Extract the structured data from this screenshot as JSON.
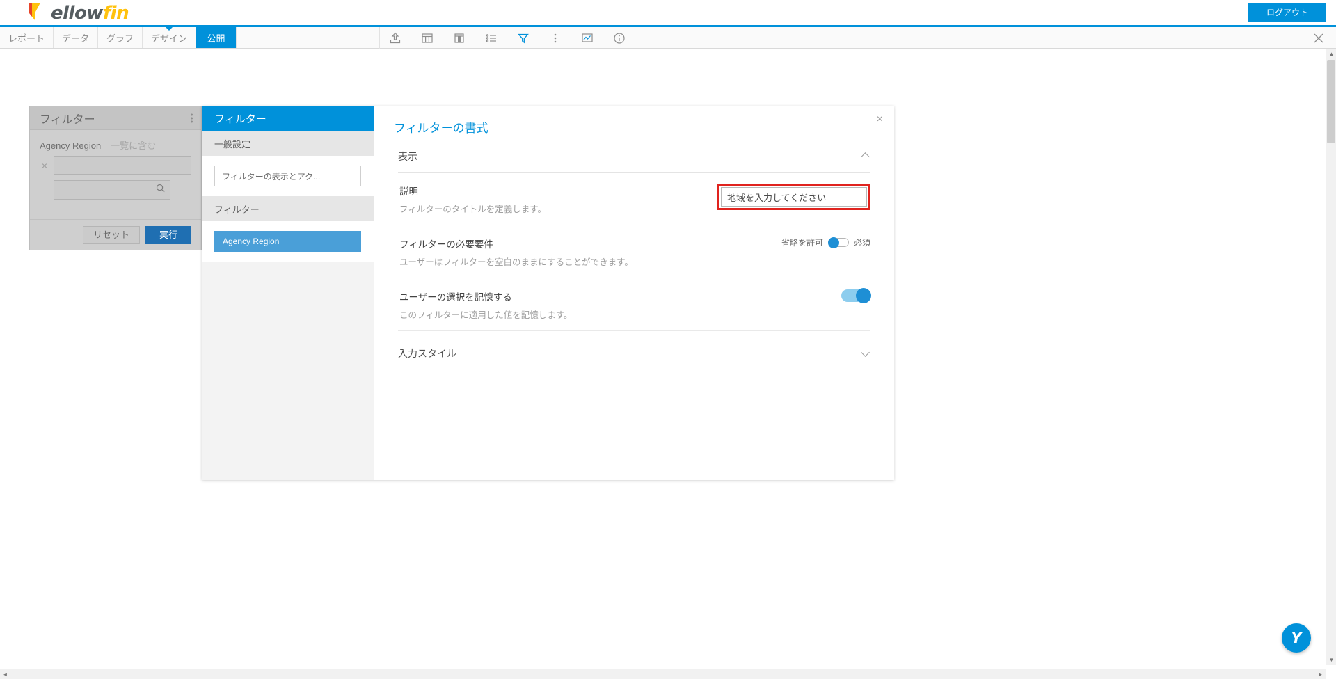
{
  "app": {
    "brand_first": "ellow",
    "brand_second": "fin",
    "logo_icon": "yellowfin-logo-icon",
    "accent_color": "#0091DA",
    "highlight_color": "#E0231E"
  },
  "topbar": {
    "logout_label": "ログアウト"
  },
  "nav": {
    "tabs": [
      {
        "label": "レポート",
        "active": false
      },
      {
        "label": "データ",
        "active": false
      },
      {
        "label": "グラフ",
        "active": false
      },
      {
        "label": "デザイン",
        "active": false
      },
      {
        "label": "公開",
        "active": true
      }
    ]
  },
  "toolbar": {
    "buttons": [
      {
        "name": "export-icon",
        "title": "エクスポート",
        "active": false
      },
      {
        "name": "table-columns-icon",
        "title": "表",
        "active": false
      },
      {
        "name": "section-layout-icon",
        "title": "セクション",
        "active": false
      },
      {
        "name": "list-icon",
        "title": "リスト",
        "active": false
      },
      {
        "name": "filter-icon",
        "title": "フィルター",
        "active": true
      },
      {
        "name": "more-vertical-icon",
        "title": "その他",
        "active": false
      },
      {
        "name": "chart-icon",
        "title": "グラフ",
        "active": false
      },
      {
        "name": "info-icon",
        "title": "情報",
        "active": false
      }
    ],
    "close_label": "×"
  },
  "filter_panel": {
    "title": "フィルター",
    "menu_icon": "kebab-menu-icon",
    "field_label": "Agency Region",
    "operator_label": "一覧に含む",
    "remove_icon": "remove-x-icon",
    "value_input_value": "",
    "search_input_value": "",
    "search_icon": "search-icon",
    "reset_label": "リセット",
    "run_label": "実行"
  },
  "modal": {
    "left": {
      "header": "フィルター",
      "section_general": "一般設定",
      "chip_label": "フィルターの表示とアク...",
      "section_filters": "フィルター",
      "items": [
        {
          "label": "Agency Region",
          "selected": true
        }
      ]
    },
    "right": {
      "title": "フィルターの書式",
      "close_icon": "close-icon",
      "sections": [
        {
          "name": "display-section",
          "heading": "表示",
          "expanded": true,
          "rows": [
            {
              "name": "description-row",
              "label": "説明",
              "desc": "フィルターのタイトルを定義します。",
              "control": "text-input",
              "value": "地域を入力してください",
              "placeholder": "",
              "highlighted": true
            },
            {
              "name": "requirement-row",
              "label": "フィルターの必要要件",
              "desc": "ユーザーはフィルターを空白のままにすることができます。",
              "control": "radio-toggle",
              "option_left": "省略を許可",
              "option_right": "必須",
              "selected": "省略を許可"
            },
            {
              "name": "remember-selection-row",
              "label": "ユーザーの選択を記憶する",
              "desc": "このフィルターに適用した値を記憶します。",
              "control": "toggle",
              "value": "on"
            }
          ]
        },
        {
          "name": "input-style-section",
          "heading": "入力スタイル",
          "expanded": false,
          "rows": []
        }
      ]
    }
  },
  "help": {
    "bubble_icon": "yellowfin-help-icon",
    "bubble_label": "Y"
  },
  "scrollbars": {
    "up_arrow": "▲",
    "down_arrow": "▼",
    "left_arrow": "◄",
    "right_arrow": "►"
  }
}
